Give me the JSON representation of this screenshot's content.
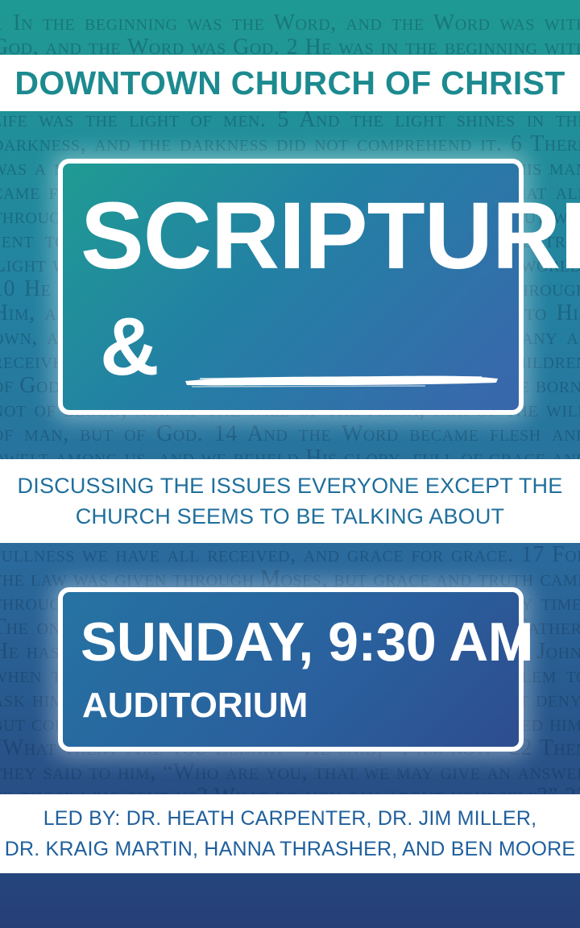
{
  "background_text": "1 In the beginning was the Word, and the Word was with God, and the Word was God. 2 He was in the beginning with God. 3 All things were made through Him, and without Him nothing was made that was made. 4 In Him was life, and the life was the light of men. 5 And the light shines in the darkness, and the darkness did not comprehend it. 6 There was a man sent from God, whose name was John. 7 This man came for a witness, to bear witness of the Light, that all through him might believe. 8 He was not that Light, but was sent to bear witness of that Light. 9 That was the true Light which gives light to every man coming into the world. 10 He was in the world, and the world was made through Him, and the world did not know Him. 11 He came to His own, and His own did not receive Him. 12 But as many as received Him, to them He gave the right to become children of God, to those who believe in His name: 13 who were born, not of blood, nor of the will of the flesh, nor of the will of man, but of God. 14 And the Word became flesh and dwelt among us, and we beheld His glory, full of grace and truth. 15 John bore witness of Him and cried out, saying, “This was He of whom I said, ‘He who comes after me is preferred before me, for He was before me.’” 16 And of His fullness we have all received, and grace for grace. 17 For the law was given through Moses, but grace and truth came through Jesus Christ. 18 No one has seen God at any time. The only begotten Son, who is in the bosom of the Father, He has declared Him. 19 Now this is the testimony of John, when the Jews sent priests and Levites from Jerusalem to ask him, “Who are you?” 20 He confessed, and did not deny, but confessed, “I am not the Christ.” 21 And they asked him, “What then? Are you Elijah?” He said, “I am not.” 22 Then they said to him, “Who are you, that we may give an answer to those who sent us? What do you say about yourself?” 23 He said: “I am ‘The voice of one crying in the wilderness.’”",
  "header": {
    "church_name": "DOWNTOWN CHURCH OF CHRIST"
  },
  "title_panel": {
    "title": "SCRIPTURE",
    "ampersand": "&"
  },
  "tagline": {
    "line1": "DISCUSSING THE ISSUES EVERYONE EXCEPT THE",
    "line2": "CHURCH SEEMS TO BE TALKING ABOUT"
  },
  "event_panel": {
    "when": "SUNDAY, 9:30 AM",
    "where": "AUDITORIUM"
  },
  "footer": {
    "line1": "LED BY: DR. HEATH CARPENTER, DR. JIM MILLER,",
    "line2": "DR. KRAIG MARTIN, HANNA THRASHER, AND BEN MOORE"
  },
  "colors": {
    "teal_accent": "#1c8a8f",
    "blue_accent": "#1f6f9c",
    "panel_border": "#ffffff"
  }
}
